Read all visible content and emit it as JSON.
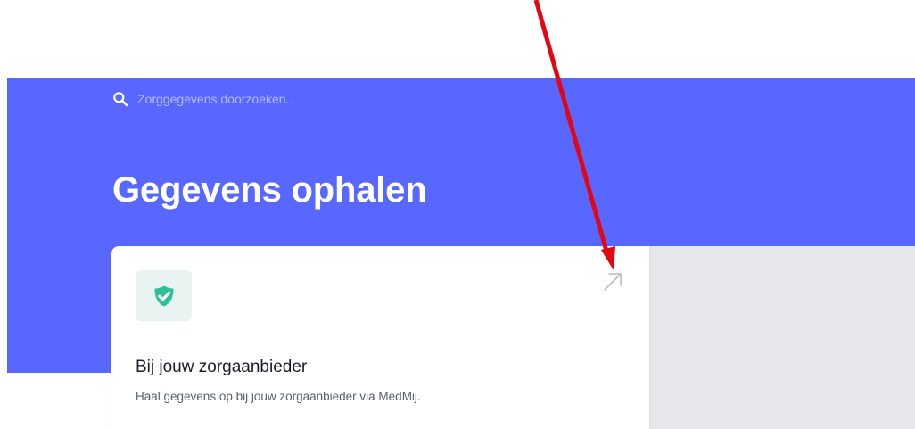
{
  "search": {
    "placeholder": "Zorggegevens doorzoeken..",
    "icon": "search-icon"
  },
  "page": {
    "title": "Gegevens ophalen"
  },
  "card": {
    "icon": "shield-check-icon",
    "link_icon": "external-link-arrow-icon",
    "title": "Bij jouw zorgaanbieder",
    "description": "Haal gegevens op bij jouw zorgaanbieder via MedMij."
  },
  "annotation": {
    "icon": "red-arrow-annotation"
  },
  "colors": {
    "hero_background": "#5867ff",
    "icon_green": "#2fbf9a",
    "icon_box_background": "#e8f3f2",
    "side_panel_background": "#e6e7eb",
    "annotation_red": "#e30613"
  }
}
